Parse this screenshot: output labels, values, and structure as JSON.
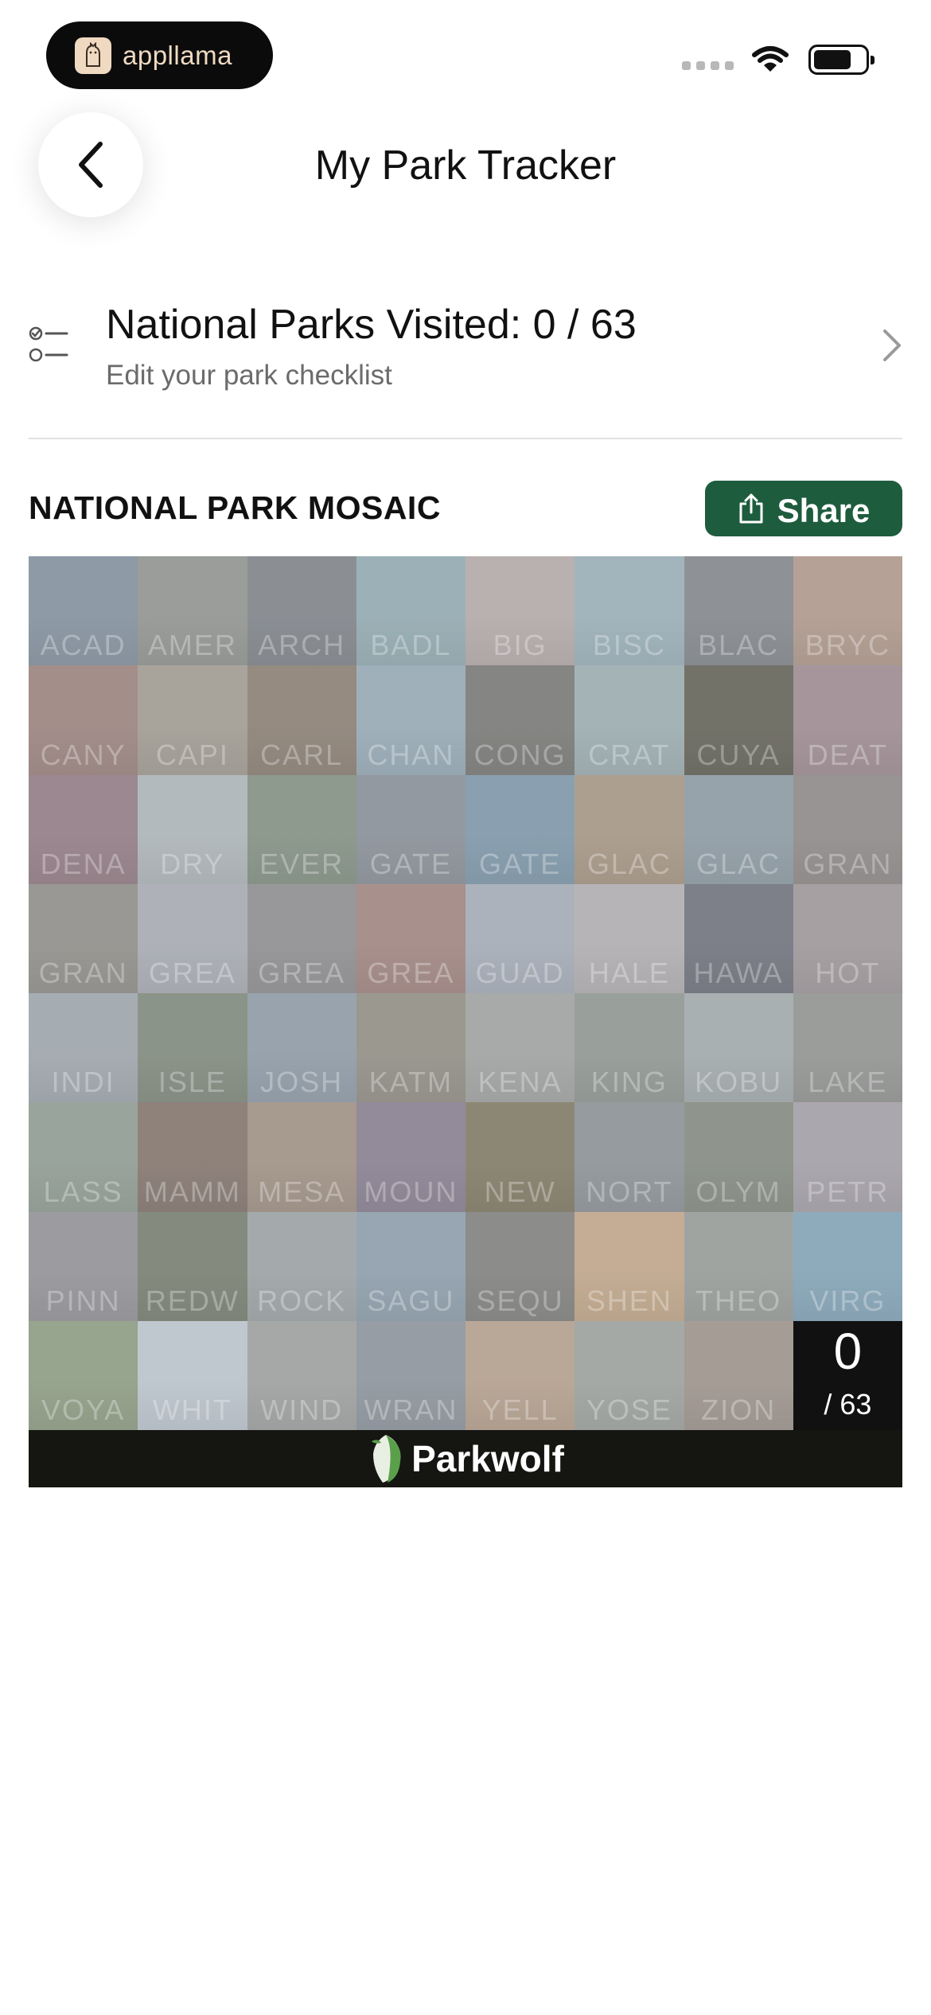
{
  "status_bar": {
    "app_pill_label": "appllama"
  },
  "header": {
    "title": "My Park Tracker"
  },
  "visited": {
    "title": "National Parks Visited: 0 / 63",
    "subtitle": "Edit your park checklist"
  },
  "mosaic": {
    "section_title": "NATIONAL PARK MOSAIC",
    "share_label": "Share",
    "counter_value": "0",
    "counter_total": "/ 63",
    "brand": "Parkwolf",
    "tiles": [
      {
        "code": "ACAD",
        "color": "#8e9aa6"
      },
      {
        "code": "AMER",
        "color": "#9a9d9a"
      },
      {
        "code": "ARCH",
        "color": "#8b8f94"
      },
      {
        "code": "BADL",
        "color": "#9cb1b7"
      },
      {
        "code": "BIG",
        "color": "#b9b0b0"
      },
      {
        "code": "BISC",
        "color": "#a2b5bd"
      },
      {
        "code": "BLAC",
        "color": "#8e9296"
      },
      {
        "code": "BRYC",
        "color": "#b5a196"
      },
      {
        "code": "CANY",
        "color": "#a38e8a"
      },
      {
        "code": "CAPI",
        "color": "#a8a49c"
      },
      {
        "code": "CARL",
        "color": "#958b81"
      },
      {
        "code": "CHAN",
        "color": "#9fb0bb"
      },
      {
        "code": "CONG",
        "color": "#858583"
      },
      {
        "code": "CRAT",
        "color": "#a4b3b6"
      },
      {
        "code": "CUYA",
        "color": "#737269"
      },
      {
        "code": "DEAT",
        "color": "#a6969c"
      },
      {
        "code": "DENA",
        "color": "#9c8890"
      },
      {
        "code": "DRY",
        "color": "#b3babd"
      },
      {
        "code": "EVER",
        "color": "#8e9a8e"
      },
      {
        "code": "GATE",
        "color": "#9399a0"
      },
      {
        "code": "GATE",
        "color": "#8aa0b0"
      },
      {
        "code": "GLAC",
        "color": "#ad9f8f"
      },
      {
        "code": "GLAC",
        "color": "#97a3ab"
      },
      {
        "code": "GRAN",
        "color": "#989493"
      },
      {
        "code": "GRAN",
        "color": "#9a9894"
      },
      {
        "code": "GREA",
        "color": "#aeb2b8"
      },
      {
        "code": "GREA",
        "color": "#98989a"
      },
      {
        "code": "GREA",
        "color": "#a8908c"
      },
      {
        "code": "GUAD",
        "color": "#abb2bc"
      },
      {
        "code": "HALE",
        "color": "#b6b4b6"
      },
      {
        "code": "HAWA",
        "color": "#7d7f89"
      },
      {
        "code": "HOT",
        "color": "#a6a0a3"
      },
      {
        "code": "INDI",
        "color": "#a6adb2"
      },
      {
        "code": "ISLE",
        "color": "#8b9488"
      },
      {
        "code": "JOSH",
        "color": "#98a3ae"
      },
      {
        "code": "KATM",
        "color": "#9b9890"
      },
      {
        "code": "KENA",
        "color": "#a8aaa9"
      },
      {
        "code": "KING",
        "color": "#99a09c"
      },
      {
        "code": "KOBU",
        "color": "#a8b0b2"
      },
      {
        "code": "LAKE",
        "color": "#9b9d9b"
      },
      {
        "code": "LASS",
        "color": "#99a49c"
      },
      {
        "code": "MAMM",
        "color": "#8e827b"
      },
      {
        "code": "MESA",
        "color": "#a79a8f"
      },
      {
        "code": "MOUN",
        "color": "#938b9a"
      },
      {
        "code": "NEW",
        "color": "#8c8774"
      },
      {
        "code": "NORT",
        "color": "#969b9f"
      },
      {
        "code": "OLYM",
        "color": "#8f958c"
      },
      {
        "code": "PETR",
        "color": "#aba7ae"
      },
      {
        "code": "PINN",
        "color": "#9c9ca0"
      },
      {
        "code": "REDW",
        "color": "#848a7e"
      },
      {
        "code": "ROCK",
        "color": "#a4aaab"
      },
      {
        "code": "SAGU",
        "color": "#97a6b2"
      },
      {
        "code": "SEQU",
        "color": "#8c8c8a"
      },
      {
        "code": "SHEN",
        "color": "#c4ad94"
      },
      {
        "code": "THEO",
        "color": "#a0a4a1"
      },
      {
        "code": "VIRG",
        "color": "#8eabbc"
      },
      {
        "code": "VOYA",
        "color": "#97a48e"
      },
      {
        "code": "WHIT",
        "color": "#bfc7cf"
      },
      {
        "code": "WIND",
        "color": "#a6a8a8"
      },
      {
        "code": "WRAN",
        "color": "#969da4"
      },
      {
        "code": "YELL",
        "color": "#b9a797"
      },
      {
        "code": "YOSE",
        "color": "#a5a9a6"
      },
      {
        "code": "ZION",
        "color": "#a59c96"
      }
    ]
  }
}
